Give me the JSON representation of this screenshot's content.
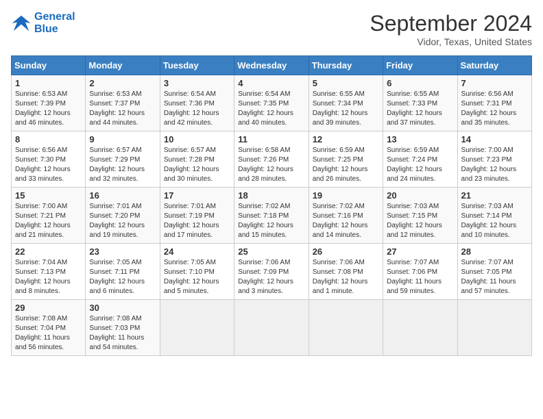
{
  "header": {
    "logo_line1": "General",
    "logo_line2": "Blue",
    "month": "September 2024",
    "location": "Vidor, Texas, United States"
  },
  "columns": [
    "Sunday",
    "Monday",
    "Tuesday",
    "Wednesday",
    "Thursday",
    "Friday",
    "Saturday"
  ],
  "weeks": [
    [
      {
        "day": "1",
        "info": "Sunrise: 6:53 AM\nSunset: 7:39 PM\nDaylight: 12 hours and 46 minutes."
      },
      {
        "day": "2",
        "info": "Sunrise: 6:53 AM\nSunset: 7:37 PM\nDaylight: 12 hours and 44 minutes."
      },
      {
        "day": "3",
        "info": "Sunrise: 6:54 AM\nSunset: 7:36 PM\nDaylight: 12 hours and 42 minutes."
      },
      {
        "day": "4",
        "info": "Sunrise: 6:54 AM\nSunset: 7:35 PM\nDaylight: 12 hours and 40 minutes."
      },
      {
        "day": "5",
        "info": "Sunrise: 6:55 AM\nSunset: 7:34 PM\nDaylight: 12 hours and 39 minutes."
      },
      {
        "day": "6",
        "info": "Sunrise: 6:55 AM\nSunset: 7:33 PM\nDaylight: 12 hours and 37 minutes."
      },
      {
        "day": "7",
        "info": "Sunrise: 6:56 AM\nSunset: 7:31 PM\nDaylight: 12 hours and 35 minutes."
      }
    ],
    [
      {
        "day": "8",
        "info": "Sunrise: 6:56 AM\nSunset: 7:30 PM\nDaylight: 12 hours and 33 minutes."
      },
      {
        "day": "9",
        "info": "Sunrise: 6:57 AM\nSunset: 7:29 PM\nDaylight: 12 hours and 32 minutes."
      },
      {
        "day": "10",
        "info": "Sunrise: 6:57 AM\nSunset: 7:28 PM\nDaylight: 12 hours and 30 minutes."
      },
      {
        "day": "11",
        "info": "Sunrise: 6:58 AM\nSunset: 7:26 PM\nDaylight: 12 hours and 28 minutes."
      },
      {
        "day": "12",
        "info": "Sunrise: 6:59 AM\nSunset: 7:25 PM\nDaylight: 12 hours and 26 minutes."
      },
      {
        "day": "13",
        "info": "Sunrise: 6:59 AM\nSunset: 7:24 PM\nDaylight: 12 hours and 24 minutes."
      },
      {
        "day": "14",
        "info": "Sunrise: 7:00 AM\nSunset: 7:23 PM\nDaylight: 12 hours and 23 minutes."
      }
    ],
    [
      {
        "day": "15",
        "info": "Sunrise: 7:00 AM\nSunset: 7:21 PM\nDaylight: 12 hours and 21 minutes."
      },
      {
        "day": "16",
        "info": "Sunrise: 7:01 AM\nSunset: 7:20 PM\nDaylight: 12 hours and 19 minutes."
      },
      {
        "day": "17",
        "info": "Sunrise: 7:01 AM\nSunset: 7:19 PM\nDaylight: 12 hours and 17 minutes."
      },
      {
        "day": "18",
        "info": "Sunrise: 7:02 AM\nSunset: 7:18 PM\nDaylight: 12 hours and 15 minutes."
      },
      {
        "day": "19",
        "info": "Sunrise: 7:02 AM\nSunset: 7:16 PM\nDaylight: 12 hours and 14 minutes."
      },
      {
        "day": "20",
        "info": "Sunrise: 7:03 AM\nSunset: 7:15 PM\nDaylight: 12 hours and 12 minutes."
      },
      {
        "day": "21",
        "info": "Sunrise: 7:03 AM\nSunset: 7:14 PM\nDaylight: 12 hours and 10 minutes."
      }
    ],
    [
      {
        "day": "22",
        "info": "Sunrise: 7:04 AM\nSunset: 7:13 PM\nDaylight: 12 hours and 8 minutes."
      },
      {
        "day": "23",
        "info": "Sunrise: 7:05 AM\nSunset: 7:11 PM\nDaylight: 12 hours and 6 minutes."
      },
      {
        "day": "24",
        "info": "Sunrise: 7:05 AM\nSunset: 7:10 PM\nDaylight: 12 hours and 5 minutes."
      },
      {
        "day": "25",
        "info": "Sunrise: 7:06 AM\nSunset: 7:09 PM\nDaylight: 12 hours and 3 minutes."
      },
      {
        "day": "26",
        "info": "Sunrise: 7:06 AM\nSunset: 7:08 PM\nDaylight: 12 hours and 1 minute."
      },
      {
        "day": "27",
        "info": "Sunrise: 7:07 AM\nSunset: 7:06 PM\nDaylight: 11 hours and 59 minutes."
      },
      {
        "day": "28",
        "info": "Sunrise: 7:07 AM\nSunset: 7:05 PM\nDaylight: 11 hours and 57 minutes."
      }
    ],
    [
      {
        "day": "29",
        "info": "Sunrise: 7:08 AM\nSunset: 7:04 PM\nDaylight: 11 hours and 56 minutes."
      },
      {
        "day": "30",
        "info": "Sunrise: 7:08 AM\nSunset: 7:03 PM\nDaylight: 11 hours and 54 minutes."
      },
      {
        "day": "",
        "info": ""
      },
      {
        "day": "",
        "info": ""
      },
      {
        "day": "",
        "info": ""
      },
      {
        "day": "",
        "info": ""
      },
      {
        "day": "",
        "info": ""
      }
    ]
  ]
}
